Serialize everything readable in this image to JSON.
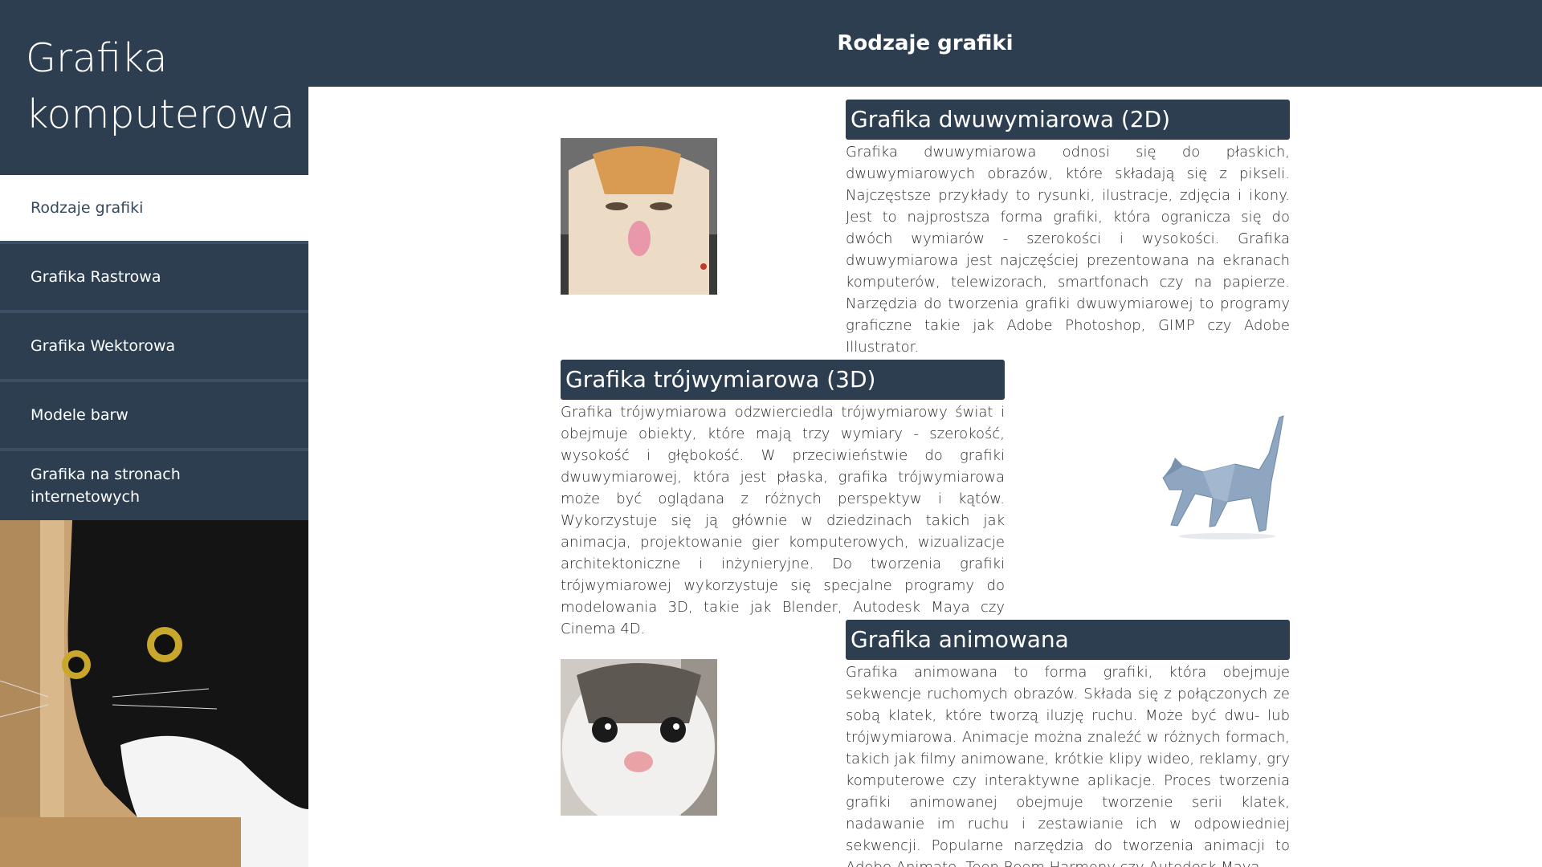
{
  "sidebar": {
    "title": "Grafika komputerowa",
    "items": [
      {
        "label": "Rodzaje grafiki",
        "active": true
      },
      {
        "label": "Grafika Rastrowa"
      },
      {
        "label": "Grafika Wektorowa"
      },
      {
        "label": "Modele barw"
      },
      {
        "label": "Grafika na stronach internetowych"
      }
    ],
    "photo_icon": "black-white-cat-photo"
  },
  "header": {
    "title": "Rodzaje grafiki"
  },
  "sections": [
    {
      "heading": "Grafika dwuwymiarowa (2D)",
      "text": "Grafika dwuwymiarowa odnosi się do płaskich, dwuwymiarowych obrazów, które składają się z pikseli. Najczęstsze przykłady to rysunki, ilustracje, zdjęcia i ikony. Jest to najprostsza forma grafiki, która ogranicza się do dwóch wymiarów - szerokości i wysokości. Grafika dwuwymiarowa jest najczęściej prezentowana na ekranach komputerów, telewizorach, smartfonach czy na papierze. Narzędzia do tworzenia grafiki dwuwymiarowej to programy graficzne takie jak Adobe Photoshop, GIMP czy Adobe Illustrator.",
      "image_icon": "cat-tongue-photo"
    },
    {
      "heading": "Grafika trójwymiarowa (3D)",
      "text": "Grafika trójwymiarowa odzwierciedla trójwymiarowy świat i obejmuje obiekty, które mają trzy wymiary - szerokość, wysokość i głębokość. W przeciwieństwie do grafiki dwuwymiarowej, która jest płaska, grafika trójwymiarowa może być oglądana z różnych perspektyw i kątów. Wykorzystuje się ją głównie w dziedzinach takich jak animacja, projektowanie gier komputerowych, wizualizacje architektoniczne i inżynieryjne. Do tworzenia grafiki trójwymiarowej wykorzystuje się specjalne programy do modelowania 3D, takie jak Blender, Autodesk Maya czy Cinema 4D.",
      "image_icon": "lowpoly-cat-3d-model"
    },
    {
      "heading": "Grafika animowana",
      "text": "Grafika animowana to forma grafiki, która obejmuje sekwencje ruchomych obrazów. Składa się z połączonych ze sobą klatek, które tworzą iluzję ruchu. Może być dwu- lub trójwymiarowa. Animacje można znaleźć w różnych formach, takich jak filmy animowane, krótkie klipy wideo, reklamy, gry komputerowe czy interaktywne aplikacje. Proces tworzenia grafiki animowanej obejmuje tworzenie serii klatek, nadawanie im ruchu i zestawianie ich w odpowiedniej sekwencji. Popularne narzędzia do tworzenia animacji to Adobe Animate, Toon Boom Harmony czy Autodesk Maya.",
      "image_icon": "cat-closeup-photo"
    }
  ],
  "colors": {
    "primary": "#2c3e50",
    "separator": "#3b4f66",
    "text": "#2b2b2b",
    "active_text": "#34495e"
  }
}
